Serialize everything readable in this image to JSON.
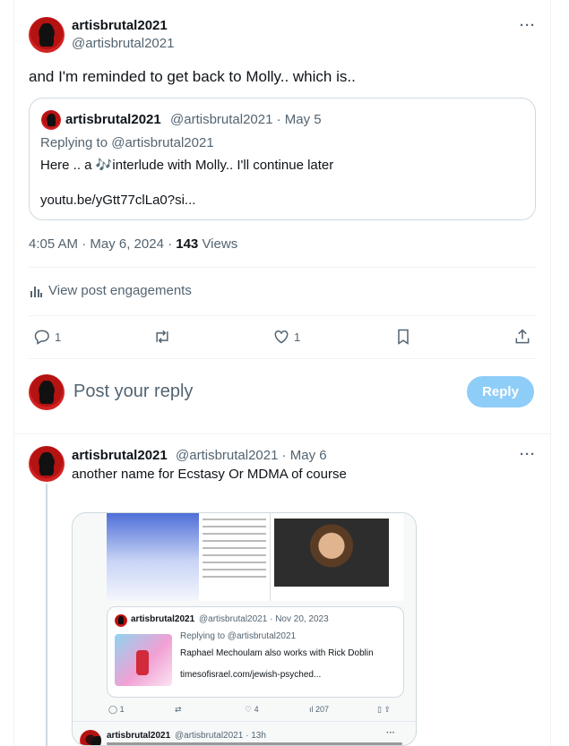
{
  "main_post": {
    "display_name": "artisbrutal2021",
    "handle": "@artisbrutal2021",
    "text": "and I'm reminded to get back to Molly.. which is..",
    "quote": {
      "display_name": "artisbrutal2021",
      "handle_date": "@artisbrutal2021 · May 5",
      "replying_to": "Replying to @artisbrutal2021",
      "text_before": "Here .. a ",
      "emoji": "🎶",
      "text_after": "interlude with Molly.. I'll continue later",
      "link": "youtu.be/yGtt77clLa0?si..."
    },
    "timestamp": "4:05 AM · May 6, 2024 · ",
    "views_count": "143",
    "views_label": " Views",
    "engagements_label": "View post engagements",
    "actions": {
      "reply_count": "1",
      "like_count": "1"
    }
  },
  "composer": {
    "placeholder": "Post your reply",
    "reply_button": "Reply"
  },
  "reply_post": {
    "display_name": "artisbrutal2021",
    "handle_date": "@artisbrutal2021 · May 6",
    "text": "another name for Ecstasy Or MDMA of course",
    "embedded": {
      "nested_name": "artisbrutal2021",
      "nested_handle_date": "@artisbrutal2021 · Nov 20, 2023",
      "nested_replying": "Replying to @artisbrutal2021",
      "nested_text": "Raphael Mechoulam also works with Rick Doblin",
      "nested_link": "timesofisrael.com/jewish-psyched...",
      "stat_reply": "1",
      "stat_like": "4",
      "stat_views": "207",
      "bottom_name": "artisbrutal2021",
      "bottom_handle_date": "@artisbrutal2021 · 13h"
    }
  },
  "colors": {
    "accent": "#1d9bf0",
    "reply_button_disabled": "#8ecdf8",
    "border": "#cfd9de"
  }
}
